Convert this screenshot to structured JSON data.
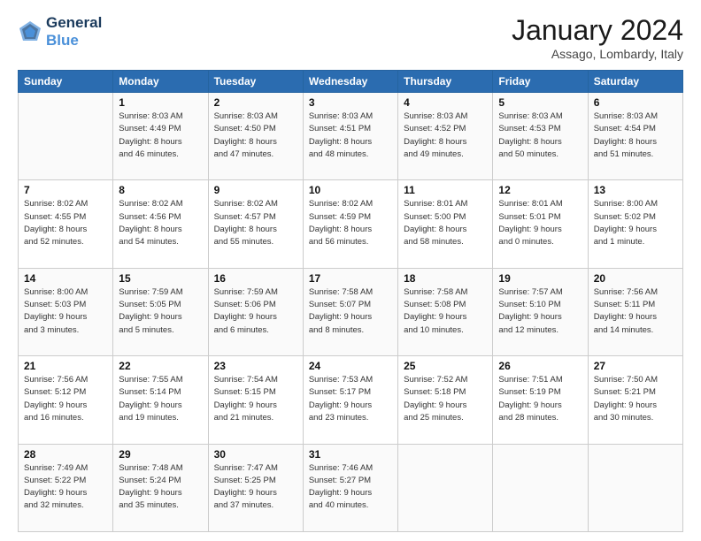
{
  "header": {
    "logo_line1": "General",
    "logo_line2": "Blue",
    "month_title": "January 2024",
    "location": "Assago, Lombardy, Italy"
  },
  "calendar": {
    "days_of_week": [
      "Sunday",
      "Monday",
      "Tuesday",
      "Wednesday",
      "Thursday",
      "Friday",
      "Saturday"
    ],
    "weeks": [
      [
        {
          "day": "",
          "info": ""
        },
        {
          "day": "1",
          "info": "Sunrise: 8:03 AM\nSunset: 4:49 PM\nDaylight: 8 hours\nand 46 minutes."
        },
        {
          "day": "2",
          "info": "Sunrise: 8:03 AM\nSunset: 4:50 PM\nDaylight: 8 hours\nand 47 minutes."
        },
        {
          "day": "3",
          "info": "Sunrise: 8:03 AM\nSunset: 4:51 PM\nDaylight: 8 hours\nand 48 minutes."
        },
        {
          "day": "4",
          "info": "Sunrise: 8:03 AM\nSunset: 4:52 PM\nDaylight: 8 hours\nand 49 minutes."
        },
        {
          "day": "5",
          "info": "Sunrise: 8:03 AM\nSunset: 4:53 PM\nDaylight: 8 hours\nand 50 minutes."
        },
        {
          "day": "6",
          "info": "Sunrise: 8:03 AM\nSunset: 4:54 PM\nDaylight: 8 hours\nand 51 minutes."
        }
      ],
      [
        {
          "day": "7",
          "info": "Sunrise: 8:02 AM\nSunset: 4:55 PM\nDaylight: 8 hours\nand 52 minutes."
        },
        {
          "day": "8",
          "info": "Sunrise: 8:02 AM\nSunset: 4:56 PM\nDaylight: 8 hours\nand 54 minutes."
        },
        {
          "day": "9",
          "info": "Sunrise: 8:02 AM\nSunset: 4:57 PM\nDaylight: 8 hours\nand 55 minutes."
        },
        {
          "day": "10",
          "info": "Sunrise: 8:02 AM\nSunset: 4:59 PM\nDaylight: 8 hours\nand 56 minutes."
        },
        {
          "day": "11",
          "info": "Sunrise: 8:01 AM\nSunset: 5:00 PM\nDaylight: 8 hours\nand 58 minutes."
        },
        {
          "day": "12",
          "info": "Sunrise: 8:01 AM\nSunset: 5:01 PM\nDaylight: 9 hours\nand 0 minutes."
        },
        {
          "day": "13",
          "info": "Sunrise: 8:00 AM\nSunset: 5:02 PM\nDaylight: 9 hours\nand 1 minute."
        }
      ],
      [
        {
          "day": "14",
          "info": "Sunrise: 8:00 AM\nSunset: 5:03 PM\nDaylight: 9 hours\nand 3 minutes."
        },
        {
          "day": "15",
          "info": "Sunrise: 7:59 AM\nSunset: 5:05 PM\nDaylight: 9 hours\nand 5 minutes."
        },
        {
          "day": "16",
          "info": "Sunrise: 7:59 AM\nSunset: 5:06 PM\nDaylight: 9 hours\nand 6 minutes."
        },
        {
          "day": "17",
          "info": "Sunrise: 7:58 AM\nSunset: 5:07 PM\nDaylight: 9 hours\nand 8 minutes."
        },
        {
          "day": "18",
          "info": "Sunrise: 7:58 AM\nSunset: 5:08 PM\nDaylight: 9 hours\nand 10 minutes."
        },
        {
          "day": "19",
          "info": "Sunrise: 7:57 AM\nSunset: 5:10 PM\nDaylight: 9 hours\nand 12 minutes."
        },
        {
          "day": "20",
          "info": "Sunrise: 7:56 AM\nSunset: 5:11 PM\nDaylight: 9 hours\nand 14 minutes."
        }
      ],
      [
        {
          "day": "21",
          "info": "Sunrise: 7:56 AM\nSunset: 5:12 PM\nDaylight: 9 hours\nand 16 minutes."
        },
        {
          "day": "22",
          "info": "Sunrise: 7:55 AM\nSunset: 5:14 PM\nDaylight: 9 hours\nand 19 minutes."
        },
        {
          "day": "23",
          "info": "Sunrise: 7:54 AM\nSunset: 5:15 PM\nDaylight: 9 hours\nand 21 minutes."
        },
        {
          "day": "24",
          "info": "Sunrise: 7:53 AM\nSunset: 5:17 PM\nDaylight: 9 hours\nand 23 minutes."
        },
        {
          "day": "25",
          "info": "Sunrise: 7:52 AM\nSunset: 5:18 PM\nDaylight: 9 hours\nand 25 minutes."
        },
        {
          "day": "26",
          "info": "Sunrise: 7:51 AM\nSunset: 5:19 PM\nDaylight: 9 hours\nand 28 minutes."
        },
        {
          "day": "27",
          "info": "Sunrise: 7:50 AM\nSunset: 5:21 PM\nDaylight: 9 hours\nand 30 minutes."
        }
      ],
      [
        {
          "day": "28",
          "info": "Sunrise: 7:49 AM\nSunset: 5:22 PM\nDaylight: 9 hours\nand 32 minutes."
        },
        {
          "day": "29",
          "info": "Sunrise: 7:48 AM\nSunset: 5:24 PM\nDaylight: 9 hours\nand 35 minutes."
        },
        {
          "day": "30",
          "info": "Sunrise: 7:47 AM\nSunset: 5:25 PM\nDaylight: 9 hours\nand 37 minutes."
        },
        {
          "day": "31",
          "info": "Sunrise: 7:46 AM\nSunset: 5:27 PM\nDaylight: 9 hours\nand 40 minutes."
        },
        {
          "day": "",
          "info": ""
        },
        {
          "day": "",
          "info": ""
        },
        {
          "day": "",
          "info": ""
        }
      ]
    ]
  }
}
